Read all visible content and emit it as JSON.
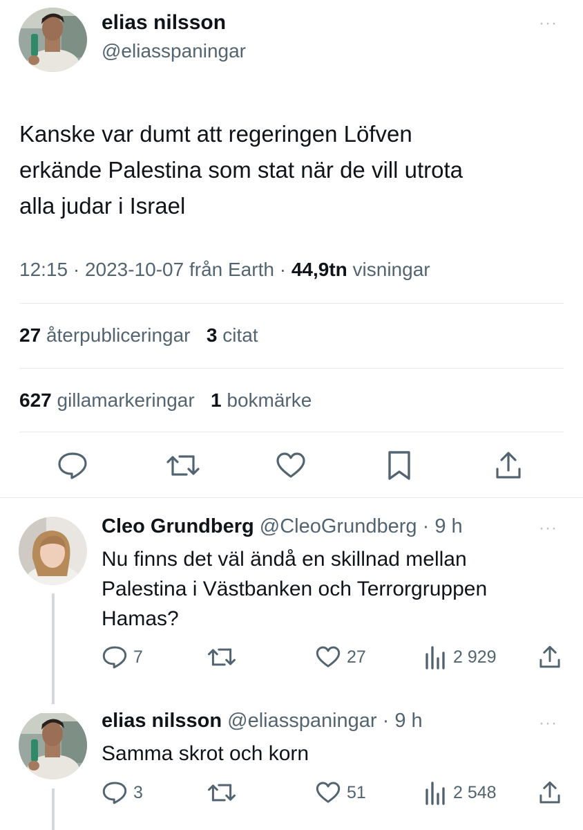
{
  "tweet": {
    "author_name": "elias nilsson",
    "author_handle": "@eliasspaningar",
    "text_lines": [
      "Kanske var dumt att regeringen Löfven",
      "erkände Palestina som stat när de vill utrota",
      "alla judar i Israel"
    ],
    "meta": {
      "time": "12:15",
      "sep1": " · ",
      "date": "2023-10-07",
      "source": " från Earth",
      "sep2": " · ",
      "views_count": "44,9tn",
      "views_label": " visningar"
    },
    "stats": {
      "retweets_count": "27",
      "retweets_label": "återpubliceringar",
      "quotes_count": "3",
      "quotes_label": "citat",
      "likes_count": "627",
      "likes_label": "gillamarkeringar",
      "bookmarks_count": "1",
      "bookmarks_label": "bokmärke"
    },
    "more_glyph": "···"
  },
  "replies": [
    {
      "name": "Cleo Grundberg",
      "handle": "@CleoGrundberg",
      "sep": " · ",
      "age": "9 h",
      "text_lines": [
        "Nu finns det väl ändå en skillnad mellan",
        "Palestina i Västbanken och Terrorgruppen",
        "Hamas?"
      ],
      "reply_count": "7",
      "like_count": "27",
      "view_count": "2 929",
      "more_glyph": "···"
    },
    {
      "name": "elias nilsson",
      "handle": "@eliasspaningar",
      "sep": " · ",
      "age": "9 h",
      "text_lines": [
        "Samma skrot och korn"
      ],
      "reply_count": "3",
      "like_count": "51",
      "view_count": "2 548",
      "more_glyph": "···"
    }
  ],
  "colors": {
    "text": "#0f1419",
    "secondary": "#536471",
    "divider": "#e6e8eb",
    "thread_line": "#cfd9de"
  },
  "icons": [
    "reply-icon",
    "retweet-icon",
    "like-icon",
    "bookmark-icon",
    "share-icon",
    "views-icon",
    "more-icon"
  ]
}
